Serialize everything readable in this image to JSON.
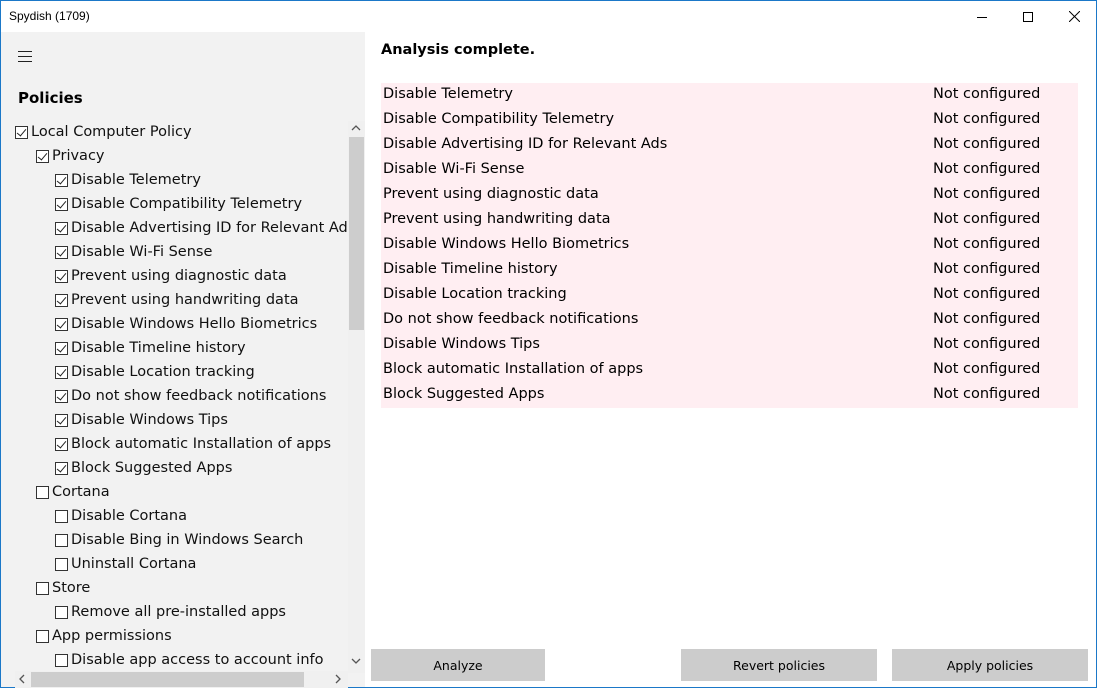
{
  "window": {
    "title": "Spydish (1709)"
  },
  "left_pane": {
    "heading": "Policies",
    "tree": [
      {
        "label": "Local Computer Policy",
        "level": 0,
        "checked": true
      },
      {
        "label": "Privacy",
        "level": 1,
        "checked": true
      },
      {
        "label": "Disable Telemetry",
        "level": 2,
        "checked": true
      },
      {
        "label": "Disable Compatibility Telemetry",
        "level": 2,
        "checked": true
      },
      {
        "label": "Disable Advertising ID for Relevant Ads",
        "level": 2,
        "checked": true
      },
      {
        "label": "Disable Wi-Fi Sense",
        "level": 2,
        "checked": true
      },
      {
        "label": "Prevent using diagnostic data",
        "level": 2,
        "checked": true
      },
      {
        "label": "Prevent using handwriting data",
        "level": 2,
        "checked": true
      },
      {
        "label": "Disable Windows Hello Biometrics",
        "level": 2,
        "checked": true
      },
      {
        "label": "Disable Timeline history",
        "level": 2,
        "checked": true
      },
      {
        "label": "Disable Location tracking",
        "level": 2,
        "checked": true
      },
      {
        "label": "Do not show feedback notifications",
        "level": 2,
        "checked": true
      },
      {
        "label": "Disable Windows Tips",
        "level": 2,
        "checked": true
      },
      {
        "label": "Block automatic Installation of apps",
        "level": 2,
        "checked": true
      },
      {
        "label": "Block Suggested Apps",
        "level": 2,
        "checked": true
      },
      {
        "label": "Cortana",
        "level": 1,
        "checked": false
      },
      {
        "label": "Disable Cortana",
        "level": 2,
        "checked": false
      },
      {
        "label": "Disable Bing in Windows Search",
        "level": 2,
        "checked": false
      },
      {
        "label": "Uninstall Cortana",
        "level": 2,
        "checked": false
      },
      {
        "label": "Store",
        "level": 1,
        "checked": false
      },
      {
        "label": "Remove all pre-installed apps",
        "level": 2,
        "checked": false
      },
      {
        "label": "App permissions",
        "level": 1,
        "checked": false
      },
      {
        "label": "Disable app access to account info",
        "level": 2,
        "checked": false
      }
    ]
  },
  "main": {
    "status": "Analysis complete.",
    "results": [
      {
        "name": "Disable Telemetry",
        "value": "Not configured"
      },
      {
        "name": "Disable Compatibility Telemetry",
        "value": "Not configured"
      },
      {
        "name": "Disable Advertising ID for Relevant Ads",
        "value": "Not configured"
      },
      {
        "name": "Disable Wi-Fi Sense",
        "value": "Not configured"
      },
      {
        "name": "Prevent using diagnostic data",
        "value": "Not configured"
      },
      {
        "name": "Prevent using handwriting data",
        "value": "Not configured"
      },
      {
        "name": "Disable Windows Hello Biometrics",
        "value": "Not configured"
      },
      {
        "name": "Disable Timeline history",
        "value": "Not configured"
      },
      {
        "name": "Disable Location tracking",
        "value": "Not configured"
      },
      {
        "name": "Do not show feedback notifications",
        "value": "Not configured"
      },
      {
        "name": "Disable Windows Tips",
        "value": "Not configured"
      },
      {
        "name": "Block automatic Installation of apps",
        "value": "Not configured"
      },
      {
        "name": "Block Suggested Apps",
        "value": "Not configured"
      }
    ]
  },
  "buttons": {
    "analyze": "Analyze",
    "revert": "Revert policies",
    "apply": "Apply policies"
  },
  "colors": {
    "result_background": "#ffeef2",
    "sidebar_background": "#f2f2f2",
    "button_background": "#cccccc",
    "window_border": "#1b78c8"
  },
  "icons": {
    "menu": "hamburger-icon",
    "minimize": "minimize-icon",
    "maximize": "maximize-icon",
    "close": "close-icon"
  }
}
